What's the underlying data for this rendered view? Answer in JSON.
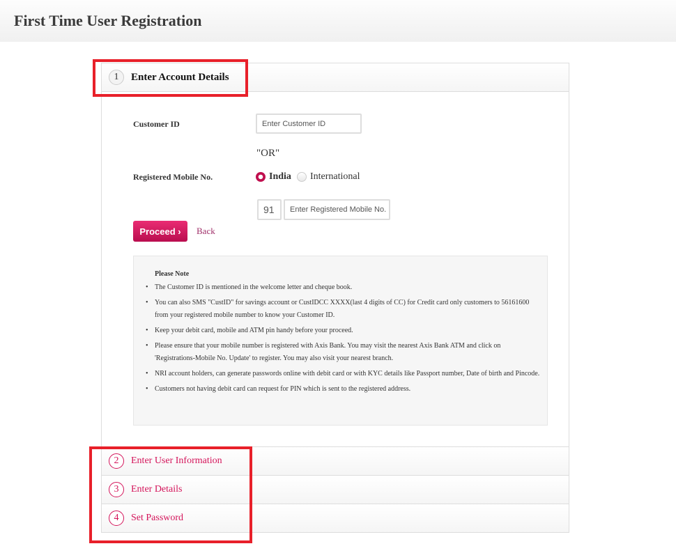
{
  "header": {
    "title": "First Time User Registration"
  },
  "step1": {
    "number": "1",
    "title": "Enter Account Details"
  },
  "form": {
    "customer_id_label": "Customer ID",
    "customer_id_placeholder": "Enter Customer ID",
    "or_text": "\"OR\"",
    "mobile_label": "Registered Mobile No.",
    "radio_india": "India",
    "radio_international": "International",
    "selected": "India",
    "country_code": "91",
    "mobile_placeholder": "Enter Registered Mobile No.",
    "proceed_label": "Proceed",
    "back_label": "Back"
  },
  "note": {
    "title": "Please Note",
    "items": [
      "The Customer ID is mentioned in the welcome letter and cheque book.",
      "You can also SMS \"CustID\" for savings account or CustIDCC XXXX(last 4 digits of CC) for Credit card only customers to 56161600 from your registered mobile number to know your Customer ID.",
      "Keep your debit card, mobile and ATM pin handy before your proceed.",
      "Please ensure that your mobile number is registered with Axis Bank. You may visit the nearest Axis Bank ATM and click on 'Registrations-Mobile No. Update' to register. You may also visit your nearest branch.",
      "NRI account holders, can generate passwords online with debit card or with KYC details like Passport number, Date of birth and Pincode.",
      "Customers not having debit card can request for PIN which is sent to the registered address."
    ]
  },
  "steps": [
    {
      "number": "2",
      "title": "Enter User Information"
    },
    {
      "number": "3",
      "title": "Enter Details"
    },
    {
      "number": "4",
      "title": "Set Password"
    }
  ],
  "colors": {
    "accent": "#d4145a",
    "annotation": "#e8202a"
  }
}
